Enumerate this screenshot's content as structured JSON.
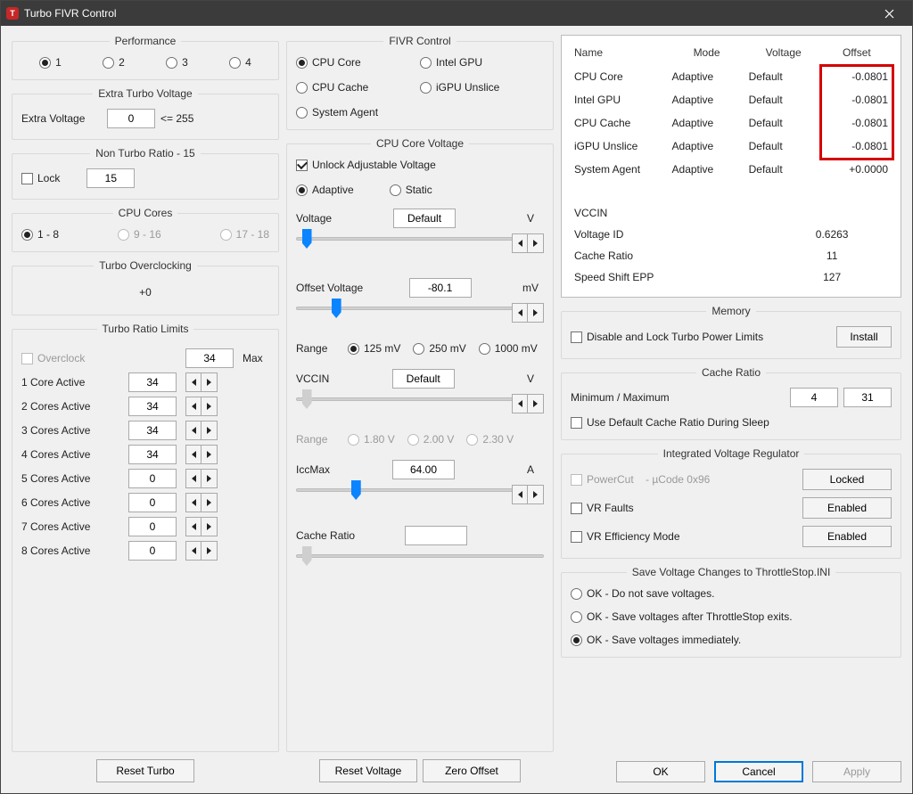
{
  "window": {
    "title": "Turbo FIVR Control"
  },
  "performance": {
    "title": "Performance",
    "options": [
      "1",
      "2",
      "3",
      "4"
    ],
    "selected": 0
  },
  "extraTurbo": {
    "title": "Extra Turbo Voltage",
    "label": "Extra Voltage",
    "value": "0",
    "suffix": "<= 255"
  },
  "nonTurbo": {
    "title": "Non Turbo Ratio - 15",
    "lockLabel": "Lock",
    "value": "15"
  },
  "cpuCores": {
    "title": "CPU Cores",
    "options": [
      "1 - 8",
      "9 - 16",
      "17 - 18"
    ],
    "selected": 0
  },
  "turboOC": {
    "title": "Turbo Overclocking",
    "value": "+0"
  },
  "turboLimits": {
    "title": "Turbo Ratio Limits",
    "overclockLabel": "Overclock",
    "maxValue": "34",
    "maxLabel": "Max",
    "rows": [
      {
        "label": "1 Core Active",
        "value": "34"
      },
      {
        "label": "2 Cores Active",
        "value": "34"
      },
      {
        "label": "3 Cores Active",
        "value": "34"
      },
      {
        "label": "4 Cores Active",
        "value": "34"
      },
      {
        "label": "5 Cores Active",
        "value": "0"
      },
      {
        "label": "6 Cores Active",
        "value": "0"
      },
      {
        "label": "7 Cores Active",
        "value": "0"
      },
      {
        "label": "8 Cores Active",
        "value": "0"
      }
    ]
  },
  "resetTurbo": "Reset Turbo",
  "fivr": {
    "title": "FIVR Control",
    "options": [
      "CPU Core",
      "Intel GPU",
      "CPU Cache",
      "iGPU Unslice",
      "System Agent"
    ],
    "selected": 0
  },
  "coreVoltage": {
    "title": "CPU Core Voltage",
    "unlockLabel": "Unlock Adjustable Voltage",
    "modes": [
      "Adaptive",
      "Static"
    ],
    "modeSelected": 0,
    "voltageLabel": "Voltage",
    "voltageValue": "Default",
    "voltageUnit": "V",
    "offsetLabel": "Offset Voltage",
    "offsetValue": "-80.1",
    "offsetUnit": "mV",
    "rangeLabel": "Range",
    "rangeOptions": [
      "125 mV",
      "250 mV",
      "1000 mV"
    ],
    "rangeSelected": 0,
    "vccinLabel": "VCCIN",
    "vccinValue": "Default",
    "vccinUnit": "V",
    "vccinRangeLabel": "Range",
    "vccinRangeOptions": [
      "1.80 V",
      "2.00 V",
      "2.30 V"
    ],
    "vccinRangeSelected": -1,
    "iccLabel": "IccMax",
    "iccValue": "64.00",
    "iccUnit": "A",
    "cacheRatioLabel": "Cache Ratio",
    "cacheRatioValue": ""
  },
  "resetVoltage": "Reset Voltage",
  "zeroOffset": "Zero Offset",
  "summary": {
    "headers": [
      "Name",
      "Mode",
      "Voltage",
      "Offset"
    ],
    "rows": [
      {
        "name": "CPU Core",
        "mode": "Adaptive",
        "voltage": "Default",
        "offset": "-0.0801"
      },
      {
        "name": "Intel GPU",
        "mode": "Adaptive",
        "voltage": "Default",
        "offset": "-0.0801"
      },
      {
        "name": "CPU Cache",
        "mode": "Adaptive",
        "voltage": "Default",
        "offset": "-0.0801"
      },
      {
        "name": "iGPU Unslice",
        "mode": "Adaptive",
        "voltage": "Default",
        "offset": "-0.0801"
      },
      {
        "name": "System Agent",
        "mode": "Adaptive",
        "voltage": "Default",
        "offset": "+0.0000"
      }
    ],
    "vccinLabel": "VCCIN",
    "kv": [
      {
        "k": "Voltage ID",
        "v": "0.6263"
      },
      {
        "k": "Cache Ratio",
        "v": "11"
      },
      {
        "k": "Speed Shift EPP",
        "v": "127"
      }
    ]
  },
  "memory": {
    "title": "Memory",
    "disableLabel": "Disable and Lock Turbo Power Limits",
    "installLabel": "Install"
  },
  "cacheRatio": {
    "title": "Cache Ratio",
    "minmaxLabel": "Minimum / Maximum",
    "min": "4",
    "max": "31",
    "defaultLabel": "Use Default Cache Ratio During Sleep"
  },
  "ivr": {
    "title": "Integrated Voltage Regulator",
    "powercutLabel": "PowerCut",
    "powercutSuffix": "- µCode 0x96",
    "lockedLabel": "Locked",
    "vrFaultsLabel": "VR Faults",
    "enabledLabel": "Enabled",
    "vrEffLabel": "VR Efficiency Mode"
  },
  "save": {
    "title": "Save Voltage Changes to ThrottleStop.INI",
    "options": [
      "OK - Do not save voltages.",
      "OK - Save voltages after ThrottleStop exits.",
      "OK - Save voltages immediately."
    ],
    "selected": 2
  },
  "buttons": {
    "ok": "OK",
    "cancel": "Cancel",
    "apply": "Apply"
  }
}
